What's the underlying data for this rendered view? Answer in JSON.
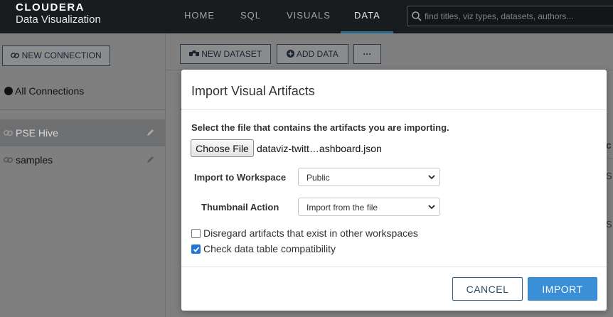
{
  "brand": {
    "line1": "CLOUDERA",
    "line2": "Data Visualization"
  },
  "nav": {
    "items": [
      {
        "label": "HOME"
      },
      {
        "label": "SQL"
      },
      {
        "label": "VISUALS"
      },
      {
        "label": "DATA"
      }
    ],
    "active": "DATA",
    "search_placeholder": "find titles, viz types, datasets, authors..."
  },
  "sidebar": {
    "new_connection_label": "NEW CONNECTION",
    "all_connections_label": "All Connections",
    "connections": [
      {
        "label": "PSE Hive",
        "selected": true
      },
      {
        "label": "samples",
        "selected": false
      }
    ]
  },
  "toolbar": {
    "new_dataset_label": "NEW DATASET",
    "add_data_label": "ADD DATA",
    "more_label": "···"
  },
  "background": {
    "col_fragment": "c",
    "cell_fragment_1": "S",
    "cell_fragment_2": "S"
  },
  "modal": {
    "title": "Import Visual Artifacts",
    "instruction": "Select the file that contains the artifacts you are importing.",
    "choose_file_label": "Choose File",
    "file_name": "dataviz-twitt…ashboard.json",
    "workspace_label": "Import to Workspace",
    "workspace_value": "Public",
    "thumbnail_label": "Thumbnail Action",
    "thumbnail_value": "Import from the file",
    "disregard_label": "Disregard artifacts that exist in other workspaces",
    "disregard_checked": false,
    "compat_label": "Check data table compatibility",
    "compat_checked": true,
    "cancel_label": "CANCEL",
    "import_label": "IMPORT"
  },
  "colors": {
    "nav_bg": "#191c1f",
    "accent": "#3a8fd6",
    "overlay": "#7f7f7f"
  }
}
